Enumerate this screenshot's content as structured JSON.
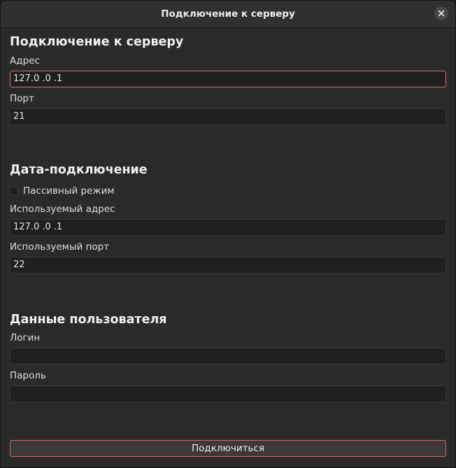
{
  "window": {
    "title": "Подключение к серверу",
    "close_icon": "close-icon"
  },
  "server_section": {
    "heading": "Подключение к серверу",
    "address_label": "Адрес",
    "address_value": "127.0  .0  .1",
    "port_label": "Порт",
    "port_value": "21"
  },
  "data_section": {
    "heading": "Дата-подключение",
    "passive_mode_label": "Пассивный режим",
    "passive_mode_checked": false,
    "used_address_label": "Используемый адрес",
    "used_address_value": "127.0  .0  .1",
    "used_port_label": "Используемый порт",
    "used_port_value": "22"
  },
  "user_section": {
    "heading": "Данные пользователя",
    "login_label": "Логин",
    "login_value": "",
    "password_label": "Пароль",
    "password_value": ""
  },
  "connect_button": "Подключиться",
  "colors": {
    "accent_border": "#d9705c",
    "background": "#2a2a2a",
    "field_background": "#1f1f1f"
  }
}
